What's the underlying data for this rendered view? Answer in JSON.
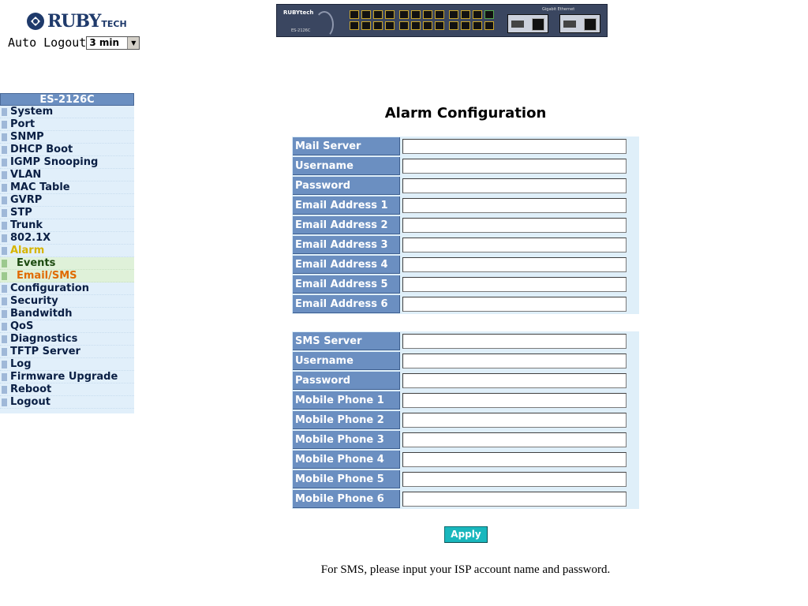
{
  "header": {
    "logo_text": "RUBY",
    "logo_sub": "TECH",
    "auto_logout_label": "Auto Logout",
    "auto_logout_value": "3 min"
  },
  "device": {
    "brand": "RUBYtech",
    "model": "ES-2126C",
    "ge_label": "Gigabit Ethernet"
  },
  "sidebar": {
    "header": "ES-2126C",
    "items_top": [
      "System",
      "Port",
      "SNMP",
      "DHCP Boot",
      "IGMP Snooping",
      "VLAN",
      "MAC Table",
      "GVRP",
      "STP",
      "Trunk",
      "802.1X"
    ],
    "alarm": "Alarm",
    "alarm_sub": [
      "Events",
      "Email/SMS"
    ],
    "items_bottom": [
      "Configuration",
      "Security",
      "Bandwitdh",
      "QoS",
      "Diagnostics",
      "TFTP Server",
      "Log",
      "Firmware Upgrade",
      "Reboot",
      "Logout"
    ]
  },
  "main": {
    "title": "Alarm Configuration",
    "email_rows": [
      {
        "label": "Mail Server",
        "value": ""
      },
      {
        "label": "Username",
        "value": ""
      },
      {
        "label": "Password",
        "value": ""
      },
      {
        "label": "Email Address 1",
        "value": ""
      },
      {
        "label": "Email Address 2",
        "value": ""
      },
      {
        "label": "Email Address 3",
        "value": ""
      },
      {
        "label": "Email Address 4",
        "value": ""
      },
      {
        "label": "Email Address 5",
        "value": ""
      },
      {
        "label": "Email Address 6",
        "value": ""
      }
    ],
    "sms_rows": [
      {
        "label": "SMS Server",
        "value": ""
      },
      {
        "label": "Username",
        "value": ""
      },
      {
        "label": "Password",
        "value": ""
      },
      {
        "label": "Mobile Phone 1",
        "value": ""
      },
      {
        "label": "Mobile Phone 2",
        "value": ""
      },
      {
        "label": "Mobile Phone 3",
        "value": ""
      },
      {
        "label": "Mobile Phone 4",
        "value": ""
      },
      {
        "label": "Mobile Phone 5",
        "value": ""
      },
      {
        "label": "Mobile Phone 6",
        "value": ""
      }
    ],
    "apply_label": "Apply",
    "note": "For SMS, please input your ISP account name and password."
  },
  "colors": {
    "label_bg": "#6b8fc1",
    "sidebar_bg": "#e1effa",
    "submenu_bg": "#dff1d9",
    "active_alarm": "#d6b400",
    "active_sub": "#e06b00",
    "apply_bg": "#19b7bd"
  }
}
